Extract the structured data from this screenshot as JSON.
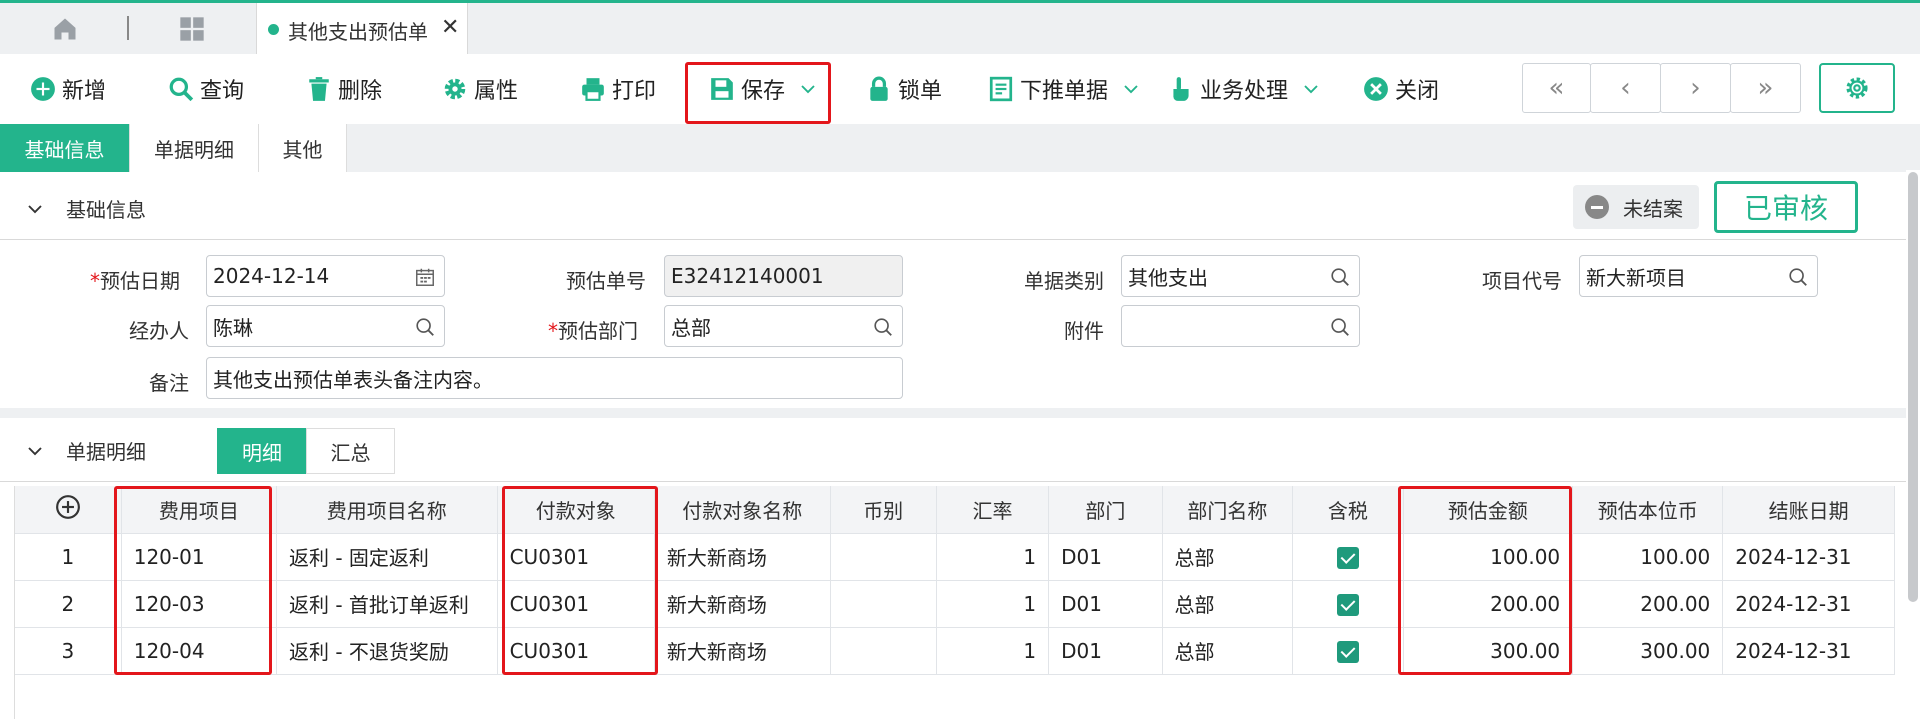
{
  "tabbar": {
    "doc_tab_label": "其他支出预估单",
    "close_glyph": "✕"
  },
  "toolbar": {
    "add": "新增",
    "query": "查询",
    "delete": "删除",
    "properties": "属性",
    "print": "打印",
    "save": "保存",
    "lock": "锁单",
    "push_down": "下推单据",
    "business": "业务处理",
    "close": "关闭",
    "nav": [
      "«",
      "‹",
      "›",
      "»"
    ]
  },
  "section_tabs": [
    "基础信息",
    "单据明细",
    "其他"
  ],
  "basic": {
    "title": "基础信息",
    "status": "未结案",
    "approval": "已审核"
  },
  "form": {
    "date_label": "预估日期",
    "date_value": "2024-12-14",
    "no_label": "预估单号",
    "no_value": "E32412140001",
    "type_label": "单据类别",
    "type_value": "其他支出",
    "project_label": "项目代号",
    "project_value": "新大新项目",
    "handler_label": "经办人",
    "handler_value": "陈琳",
    "dept_label": "预估部门",
    "dept_value": "总部",
    "attach_label": "附件",
    "attach_value": "",
    "remark_label": "备注",
    "remark_value": "其他支出预估单表头备注内容。"
  },
  "detail": {
    "title": "单据明细",
    "seg_detail": "明细",
    "seg_summary": "汇总",
    "columns": [
      "费用项目",
      "费用项目名称",
      "付款对象",
      "付款对象名称",
      "币别",
      "汇率",
      "部门",
      "部门名称",
      "含税",
      "预估金额",
      "预估本位币",
      "结账日期"
    ],
    "rows": [
      {
        "no": "1",
        "item": "120-01",
        "item_name": "返利 - 固定返利",
        "payee": "CU0301",
        "payee_name": "新大新商场",
        "currency": "",
        "rate": "1",
        "dept": "D01",
        "dept_name": "总部",
        "tax": true,
        "amount": "100.00",
        "base": "100.00",
        "date": "2024-12-31"
      },
      {
        "no": "2",
        "item": "120-03",
        "item_name": "返利 - 首批订单返利",
        "payee": "CU0301",
        "payee_name": "新大新商场",
        "currency": "",
        "rate": "1",
        "dept": "D01",
        "dept_name": "总部",
        "tax": true,
        "amount": "200.00",
        "base": "200.00",
        "date": "2024-12-31"
      },
      {
        "no": "3",
        "item": "120-04",
        "item_name": "返利 - 不退货奖励",
        "payee": "CU0301",
        "payee_name": "新大新商场",
        "currency": "",
        "rate": "1",
        "dept": "D01",
        "dept_name": "总部",
        "tax": true,
        "amount": "300.00",
        "base": "300.00",
        "date": "2024-12-31"
      }
    ]
  },
  "colors": {
    "accent": "#23b48c",
    "highlight": "#e3161b"
  }
}
